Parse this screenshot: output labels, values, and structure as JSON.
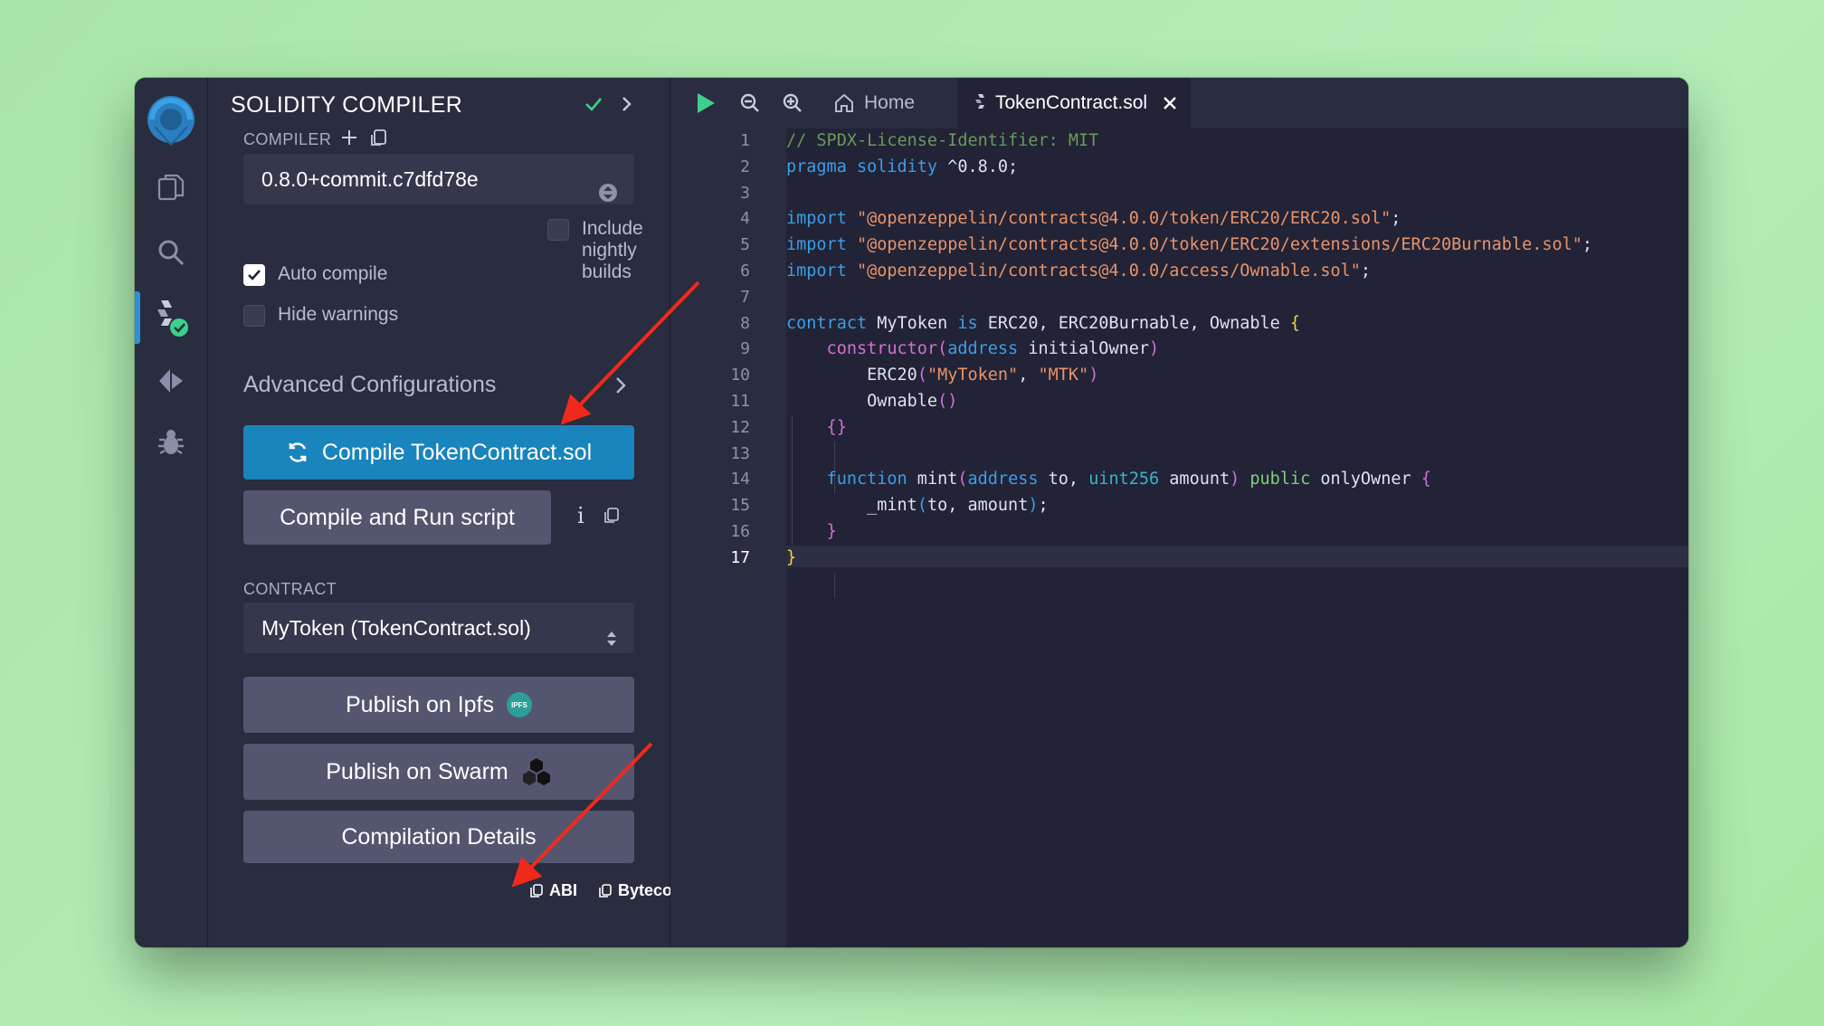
{
  "panel": {
    "title": "SOLIDITY COMPILER",
    "compiler_label": "COMPILER",
    "compiler_version": "0.8.0+commit.c7dfd78e",
    "nightly_label": "Include nightly builds",
    "auto_compile_label": "Auto compile",
    "hide_warnings_label": "Hide warnings",
    "advanced_label": "Advanced Configurations",
    "compile_button": "Compile TokenContract.sol",
    "compile_run_button": "Compile and Run script",
    "info_glyph": "i",
    "contract_label": "CONTRACT",
    "contract_selected": "MyToken (TokenContract.sol)",
    "publish_ipfs": "Publish on Ipfs",
    "ipfs_badge": "IPFS",
    "publish_swarm": "Publish on Swarm",
    "compilation_details": "Compilation Details",
    "abi_label": "ABI",
    "bytecode_label": "Bytecode",
    "auto_compile_checked": true,
    "hide_warnings_checked": false,
    "nightly_checked": false
  },
  "editor": {
    "tabs": [
      {
        "label": "Home"
      },
      {
        "label": "TokenContract.sol"
      }
    ],
    "line_numbers": [
      "1",
      "2",
      "3",
      "4",
      "5",
      "6",
      "7",
      "8",
      "9",
      "10",
      "11",
      "12",
      "13",
      "14",
      "15",
      "16",
      "17"
    ],
    "current_line": "17",
    "code": {
      "l1": "// SPDX-License-Identifier: MIT",
      "l2_kw": "pragma solidity",
      "l2_rest": " ^0.8.0;",
      "l4_kw": "import",
      "l4_str": "\"@openzeppelin/contracts@4.0.0/token/ERC20/ERC20.sol\"",
      "l5_kw": "import",
      "l5_str": "\"@openzeppelin/contracts@4.0.0/token/ERC20/extensions/ERC20Burnable.sol\"",
      "l6_kw": "import",
      "l6_str": "\"@openzeppelin/contracts@4.0.0/access/Ownable.sol\"",
      "semi": ";",
      "l8_kw": "contract",
      "l8_name": " MyToken ",
      "l8_is": "is",
      "l8_rest": " ERC20, ERC20Burnable, Ownable ",
      "l8_brace": "{",
      "l9_kw": "constructor",
      "l9_p1": "(",
      "l9_type": "address",
      "l9_arg": " initialOwner",
      "l9_p2": ")",
      "l10_fn": "ERC20",
      "l10_p1": "(",
      "l10_s1": "\"MyToken\"",
      "l10_c": ", ",
      "l10_s2": "\"MTK\"",
      "l10_p2": ")",
      "l11_fn": "Ownable",
      "l11_p": "()",
      "l12": "{}",
      "l14_kw": "function",
      "l14_fn": " mint",
      "l14_p1": "(",
      "l14_t1": "address",
      "l14_a1": " to, ",
      "l14_t2": "uint256",
      "l14_a2": " amount",
      "l14_p2": ")",
      "l14_pub": " public",
      "l14_mod": " onlyOwner ",
      "l14_brace": "{",
      "l15_fn": "_mint",
      "l15_p1": "(",
      "l15_args": "to, amount",
      "l15_p2": ")",
      "l15_semi": ";",
      "l16": "}",
      "l17": "}"
    }
  },
  "colors": {
    "accent": "#1a84bd",
    "check": "#3ecf8e",
    "arrow": "#f02a1a"
  }
}
